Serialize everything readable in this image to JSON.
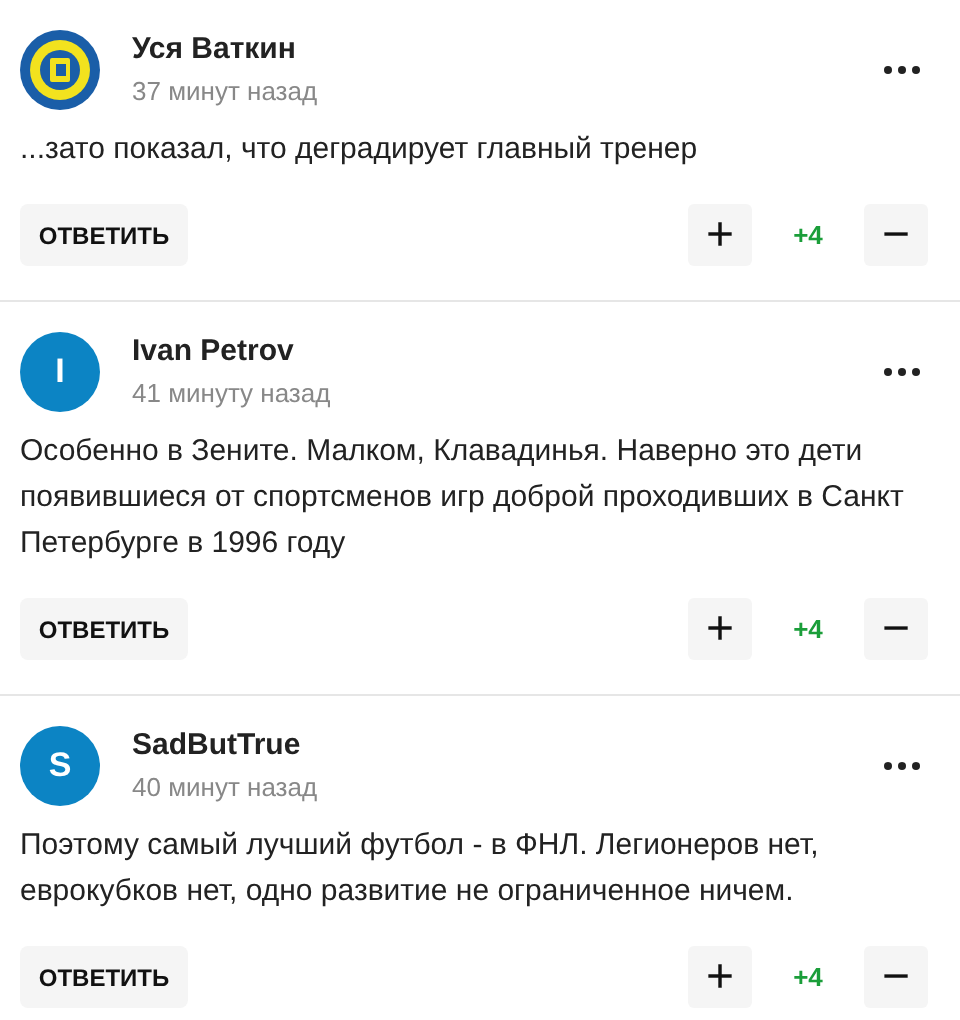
{
  "comments": [
    {
      "author": "Уся Ваткин",
      "time": "37 минут назад",
      "text": "...зато показал, что деградирует главный тренер",
      "reply": "ОТВЕТИТЬ",
      "plus": "+",
      "score": "+4",
      "minus": "−"
    },
    {
      "author": "Ivan Petrov",
      "time": "41 минуту назад",
      "avatar": {
        "kind": "letter",
        "letter": "I",
        "color": "#0c84c4"
      },
      "text": "Особенно в Зените. Малком, Клавадинья. Наверно это дети появившиеся от спортсменов игр доброй проходивших в Санкт Петербурге в 1996 году",
      "reply": "ОТВЕТИТЬ",
      "plus": "+",
      "score": "+4",
      "minus": "−"
    },
    {
      "author": "SadButTrue",
      "time": "40 минут назад",
      "avatar": {
        "kind": "letter",
        "letter": "S",
        "color": "#0c84c4"
      },
      "text": "Поэтому самый лучший футбол - в ФНЛ. Легионеров нет, еврокубков нет, одно развитие не ограниченное ничем.",
      "reply": "ОТВЕТИТЬ",
      "plus": "+",
      "score": "+4",
      "minus": "−"
    }
  ]
}
